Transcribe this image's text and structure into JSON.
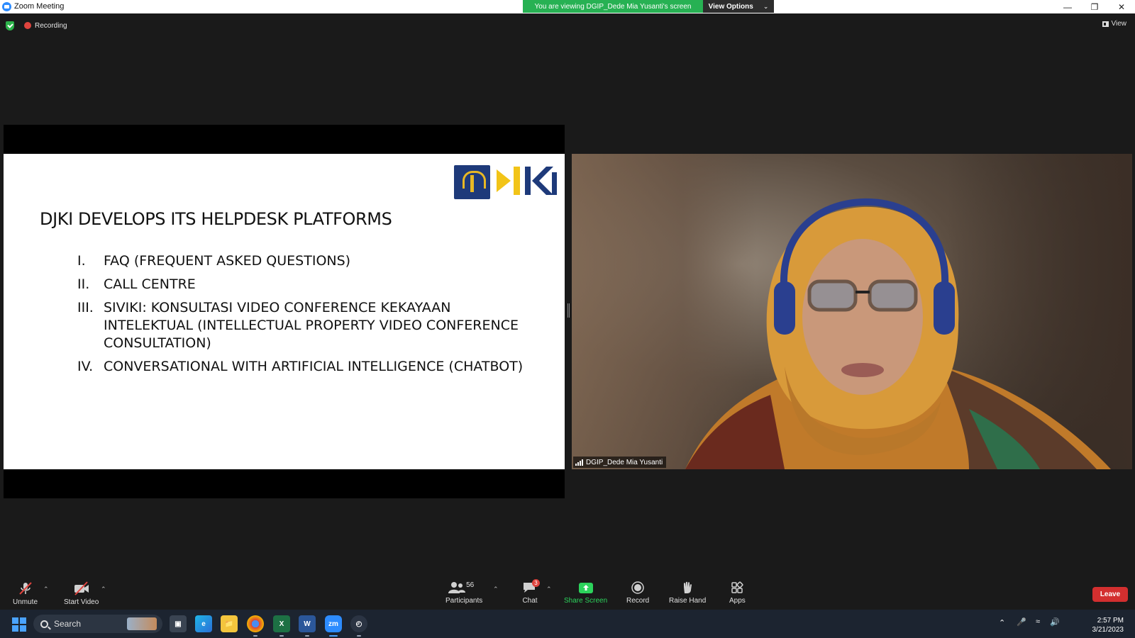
{
  "window": {
    "title": "Zoom Meeting",
    "controls": [
      "minimize",
      "restore",
      "close"
    ]
  },
  "banner": {
    "message": "You are viewing DGIP_Dede Mia Yusanti's screen",
    "options_label": "View Options"
  },
  "status": {
    "recording_label": "Recording",
    "view_label": "View"
  },
  "slide": {
    "title": "DJKI DEVELOPS ITS HELPDESK PLATFORMS",
    "logo_text": "djki",
    "items": [
      {
        "num": "I.",
        "text": "FAQ (FREQUENT ASKED QUESTIONS)"
      },
      {
        "num": "II.",
        "text": "CALL CENTRE"
      },
      {
        "num": "III.",
        "text": "SIVIKI: KONSULTASI VIDEO CONFERENCE KEKAYAAN INTELEKTUAL (INTELLECTUAL PROPERTY VIDEO CONFERENCE CONSULTATION)"
      },
      {
        "num": "IV.",
        "text": "CONVERSATIONAL WITH ARTIFICIAL INTELLIGENCE (CHATBOT)"
      }
    ]
  },
  "video": {
    "participant_name": "DGIP_Dede Mia Yusanti"
  },
  "toolbar": {
    "unmute": "Unmute",
    "start_video": "Start Video",
    "participants": "Participants",
    "participants_count": "56",
    "chat": "Chat",
    "chat_badge": "3",
    "share_screen": "Share Screen",
    "record": "Record",
    "raise_hand": "Raise Hand",
    "apps": "Apps",
    "leave": "Leave"
  },
  "taskbar": {
    "search_label": "Search",
    "time": "2:57 PM",
    "date": "3/21/2023"
  },
  "colors": {
    "banner_green": "#27b153",
    "leave_red": "#d32f2f",
    "share_green": "#2cd35c"
  }
}
